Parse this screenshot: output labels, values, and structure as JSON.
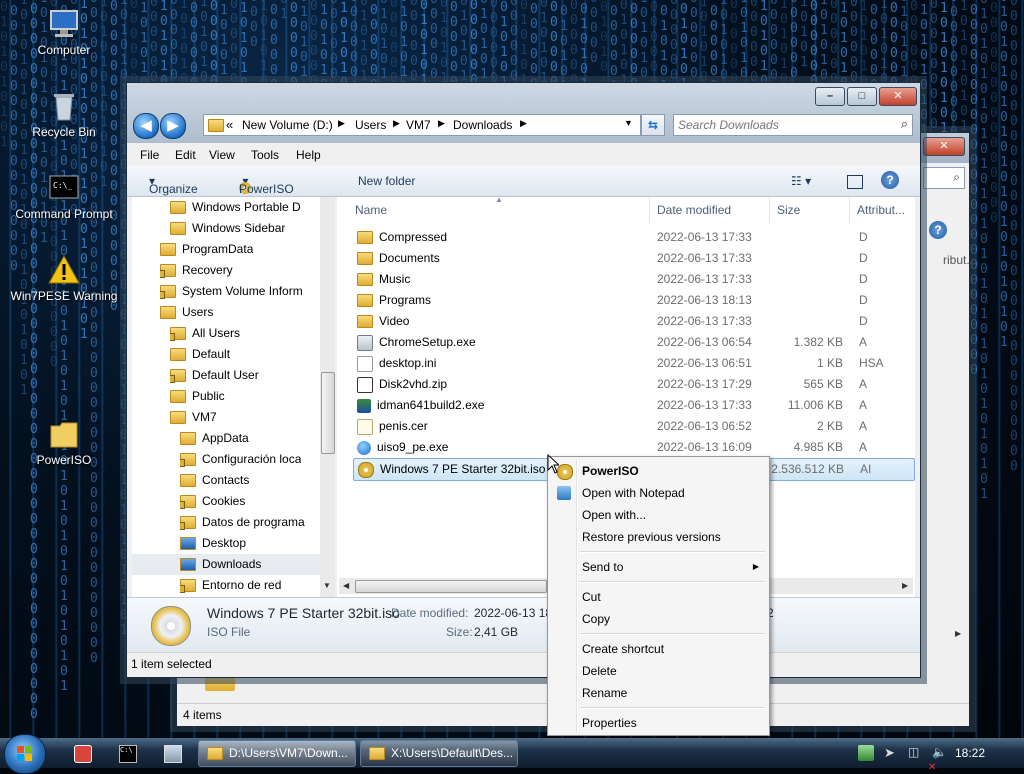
{
  "desktop": {
    "icons": [
      {
        "label": "Computer",
        "icon": "computer-icon"
      },
      {
        "label": "Recycle Bin",
        "icon": "recycle-bin-icon"
      },
      {
        "label": "Command Prompt",
        "icon": "command-prompt-icon"
      },
      {
        "label": "Win7PESE Warning",
        "icon": "warning-icon"
      },
      {
        "label": "PowerISO",
        "icon": "folder-icon"
      }
    ]
  },
  "explorer": {
    "address": {
      "chevron": "«",
      "crumbs": [
        "New Volume (D:)",
        "Users",
        "VM7",
        "Downloads"
      ]
    },
    "search_placeholder": "Search Downloads",
    "menu": [
      "File",
      "Edit",
      "View",
      "Tools",
      "Help"
    ],
    "toolbar": {
      "organize": "Organize",
      "poweriso": "PowerISO",
      "new_folder": "New folder"
    },
    "tree": [
      {
        "label": "Windows Portable D",
        "indent": 2,
        "lock": false
      },
      {
        "label": "Windows Sidebar",
        "indent": 2,
        "lock": false
      },
      {
        "label": "ProgramData",
        "indent": 1,
        "lock": false
      },
      {
        "label": "Recovery",
        "indent": 1,
        "lock": true
      },
      {
        "label": "System Volume Inform",
        "indent": 1,
        "lock": true
      },
      {
        "label": "Users",
        "indent": 1,
        "lock": false
      },
      {
        "label": "All Users",
        "indent": 2,
        "lock": true
      },
      {
        "label": "Default",
        "indent": 2,
        "lock": false
      },
      {
        "label": "Default User",
        "indent": 2,
        "lock": true
      },
      {
        "label": "Public",
        "indent": 2,
        "lock": false
      },
      {
        "label": "VM7",
        "indent": 2,
        "lock": false
      },
      {
        "label": "AppData",
        "indent": 3,
        "lock": false
      },
      {
        "label": "Configuración loca",
        "indent": 3,
        "lock": true
      },
      {
        "label": "Contacts",
        "indent": 3,
        "lock": false
      },
      {
        "label": "Cookies",
        "indent": 3,
        "lock": true
      },
      {
        "label": "Datos de programa",
        "indent": 3,
        "lock": true
      },
      {
        "label": "Desktop",
        "indent": 3,
        "lock": false
      },
      {
        "label": "Downloads",
        "indent": 3,
        "lock": false
      },
      {
        "label": "Entorno de red",
        "indent": 3,
        "lock": true
      }
    ],
    "columns": {
      "name": "Name",
      "date": "Date modified",
      "size": "Size",
      "attr": "Attribut..."
    },
    "files": [
      {
        "name": "Compressed",
        "date": "2022-06-13 17:33",
        "size": "",
        "attr": "D",
        "icon": "folder-icon"
      },
      {
        "name": "Documents",
        "date": "2022-06-13 17:33",
        "size": "",
        "attr": "D",
        "icon": "folder-icon"
      },
      {
        "name": "Music",
        "date": "2022-06-13 17:33",
        "size": "",
        "attr": "D",
        "icon": "folder-icon"
      },
      {
        "name": "Programs",
        "date": "2022-06-13 18:13",
        "size": "",
        "attr": "D",
        "icon": "folder-icon"
      },
      {
        "name": "Video",
        "date": "2022-06-13 17:33",
        "size": "",
        "attr": "D",
        "icon": "folder-icon"
      },
      {
        "name": "ChromeSetup.exe",
        "date": "2022-06-13 06:54",
        "size": "1.382 KB",
        "attr": "A",
        "icon": "exe-icon"
      },
      {
        "name": "desktop.ini",
        "date": "2022-06-13 06:51",
        "size": "1 KB",
        "attr": "HSA",
        "icon": "ini-file-icon"
      },
      {
        "name": "Disk2vhd.zip",
        "date": "2022-06-13 17:29",
        "size": "565 KB",
        "attr": "A",
        "icon": "zip-icon"
      },
      {
        "name": "idman641build2.exe",
        "date": "2022-06-13 17:33",
        "size": "11.006 KB",
        "attr": "A",
        "icon": "installer-icon"
      },
      {
        "name": "penis.cer",
        "date": "2022-06-13 06:52",
        "size": "2 KB",
        "attr": "A",
        "icon": "certificate-icon"
      },
      {
        "name": "uiso9_pe.exe",
        "date": "2022-06-13 16:09",
        "size": "4.985 KB",
        "attr": "A",
        "icon": "globe-icon"
      },
      {
        "name": "Windows 7 PE Starter 32bit.iso",
        "date": "",
        "size": "2.536.512 KB",
        "attr": "AI",
        "icon": "disc-icon"
      }
    ],
    "details": {
      "filename": "Windows 7 PE Starter 32bit.iso",
      "date_label": "Date modified:",
      "date_value": "2022-06-13 18",
      "date_tail": "2",
      "type": "ISO File",
      "size_label": "Size:",
      "size_value": "2,41 GB"
    },
    "status": "1 item selected"
  },
  "back_window": {
    "status": "4 items"
  },
  "context_menu": {
    "items": [
      {
        "label": "PowerISO",
        "bold": true,
        "icon": "poweriso-icon",
        "arrow": false,
        "sep_after": false
      },
      {
        "label": "Open with Notepad",
        "bold": false,
        "icon": "notepad-icon",
        "arrow": false,
        "sep_after": false
      },
      {
        "label": "Open with...",
        "bold": false,
        "icon": "",
        "arrow": false,
        "sep_after": false
      },
      {
        "label": "Restore previous versions",
        "bold": false,
        "icon": "",
        "arrow": false,
        "sep_after": true
      },
      {
        "label": "Send to",
        "bold": false,
        "icon": "",
        "arrow": true,
        "sep_after": true
      },
      {
        "label": "Cut",
        "bold": false,
        "icon": "",
        "arrow": false,
        "sep_after": false
      },
      {
        "label": "Copy",
        "bold": false,
        "icon": "",
        "arrow": false,
        "sep_after": true
      },
      {
        "label": "Create shortcut",
        "bold": false,
        "icon": "",
        "arrow": false,
        "sep_after": false
      },
      {
        "label": "Delete",
        "bold": false,
        "icon": "",
        "arrow": false,
        "sep_after": false
      },
      {
        "label": "Rename",
        "bold": false,
        "icon": "",
        "arrow": false,
        "sep_after": true
      },
      {
        "label": "Properties",
        "bold": false,
        "icon": "",
        "arrow": false,
        "sep_after": false
      }
    ]
  },
  "taskbar": {
    "tasks": [
      "D:\\Users\\VM7\\Down...",
      "X:\\Users\\Default\\Des..."
    ],
    "clock": "18:22"
  },
  "colors": {
    "selection": "#cde6f7",
    "accent": "#1f6fc9",
    "close": "#c2412b"
  }
}
